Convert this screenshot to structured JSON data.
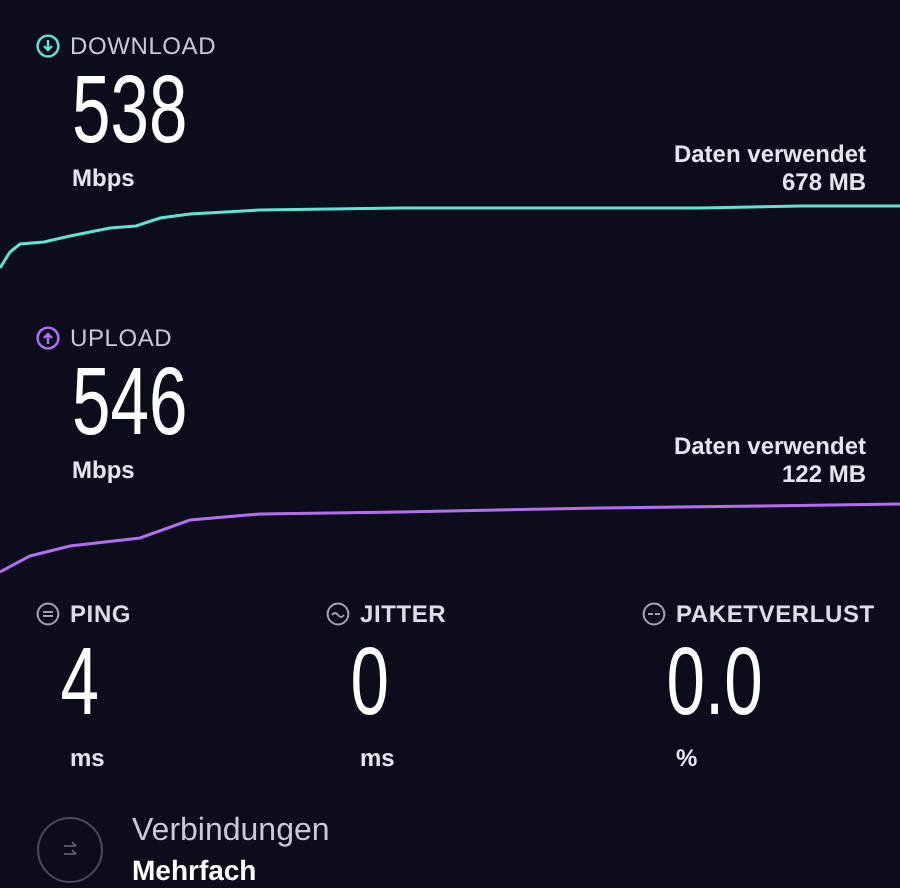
{
  "results": [
    {
      "kind": "download",
      "label": "DOWNLOAD",
      "value": "538",
      "unit": "Mbps",
      "data_label": "Daten verwendet",
      "data_value": "678 MB",
      "color": "#5fe3d2"
    },
    {
      "kind": "upload",
      "label": "UPLOAD",
      "value": "546",
      "unit": "Mbps",
      "data_label": "Daten verwendet",
      "data_value": "122 MB",
      "color": "#b36ef0"
    }
  ],
  "metrics": [
    {
      "kind": "ping",
      "label": "PING",
      "value": "4",
      "unit": "ms"
    },
    {
      "kind": "jitter",
      "label": "JITTER",
      "value": "0",
      "unit": "ms"
    },
    {
      "kind": "loss",
      "label": "PAKETVERLUST",
      "value": "0.0",
      "unit": "%"
    }
  ],
  "connections": {
    "label": "Verbindungen",
    "value": "Mehrfach"
  }
}
